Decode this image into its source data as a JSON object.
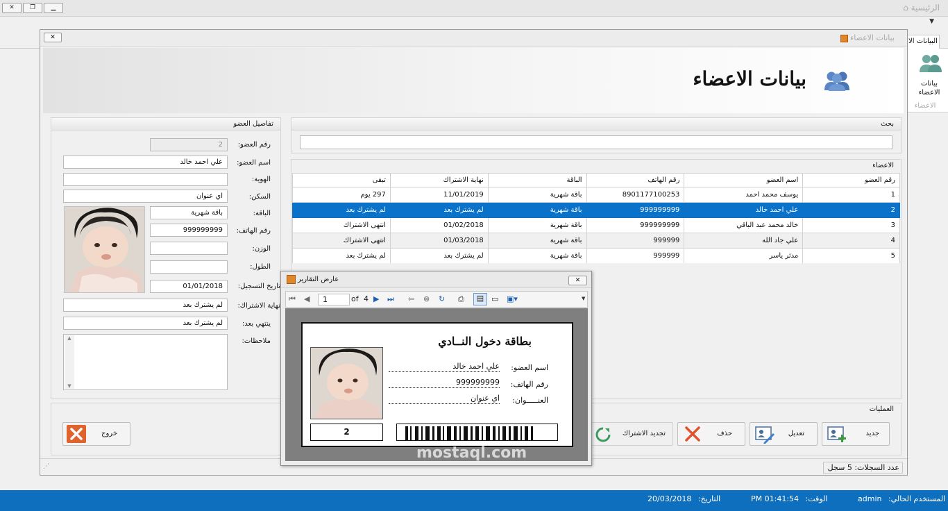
{
  "app": {
    "title": "الرئيسية",
    "window_buttons": [
      "▁",
      "❐",
      "▁"
    ],
    "ribbon_dropdown": "▼",
    "ribbon_tab": "البيانات الا",
    "ribbon_button": "بيانات\nالاعضاء",
    "ribbon_group": "الاعضاء"
  },
  "child": {
    "title": "بيانات الاعضاء",
    "close": "✕",
    "page_title": "بيانات الاعضاء"
  },
  "details": {
    "title": "تفاصيل العضو",
    "fields": [
      {
        "label": "رقم العضو:",
        "value": "2",
        "disabled": true
      },
      {
        "label": "اسم العضو:",
        "value": "علي احمد خالد"
      },
      {
        "label": "الهوية:",
        "value": ""
      },
      {
        "label": "السكن:",
        "value": "اي عنوان"
      },
      {
        "label": "الباقة:",
        "value": "باقة شهرية"
      },
      {
        "label": "رقم الهاتف:",
        "value": "999999999"
      },
      {
        "label": "الوزن:",
        "value": ""
      },
      {
        "label": "الطول:",
        "value": ""
      },
      {
        "label": "تاريخ التسجيل:",
        "value": "01/01/2018"
      },
      {
        "label": "نهاية الاشتراك:",
        "value": "لم يشترك بعد"
      },
      {
        "label": "ينتهي بعد:",
        "value": "لم يشترك بعد"
      },
      {
        "label": "ملاحظات:",
        "value": ""
      }
    ]
  },
  "search": {
    "title": "بحث",
    "value": ""
  },
  "members": {
    "title": "الاعضاء",
    "columns": [
      "رقم العضو",
      "اسم العضو",
      "رقم الهاتف",
      "الباقة",
      "نهاية الاشتراك",
      "تبقى"
    ],
    "rows": [
      [
        "1",
        "يوسف محمد احمد",
        "8901177100253",
        "باقة شهرية",
        "11/01/2019",
        "297 يوم"
      ],
      [
        "2",
        "علي احمد خالد",
        "999999999",
        "باقة شهرية",
        "لم يشترك بعد",
        "لم يشترك بعد"
      ],
      [
        "3",
        "خالد محمد عبد الباقي",
        "999999999",
        "باقة شهرية",
        "01/02/2018",
        "انتهى الاشتراك"
      ],
      [
        "4",
        "علي جاد الله",
        "999999",
        "باقة شهرية",
        "01/03/2018",
        "انتهى الاشتراك"
      ],
      [
        "5",
        "مدثر ياسر",
        "999999",
        "باقة شهرية",
        "لم يشترك بعد",
        "لم يشترك بعد"
      ]
    ],
    "selected_row": 1
  },
  "operations": {
    "title": "العمليات",
    "new": "جديد",
    "edit": "تعديل",
    "delete": "حذف",
    "renew": "تجديد الاشتراك",
    "exit": "خروج"
  },
  "record_count": {
    "label": "عدد السجلات:",
    "value": "5 سجل"
  },
  "report_viewer": {
    "title": "عارض التقارير",
    "close": "✕",
    "page": "1",
    "of_label": "of",
    "total_pages": "4",
    "card": {
      "title": "بطاقة دخول النــادي",
      "name_label": "اسم العضو:",
      "name": "علي احمد خالد",
      "phone_label": "رقم الهاتف:",
      "phone": "999999999",
      "address_label": "العنـــــوان:",
      "address": "اي عنوان",
      "member_no": "2"
    }
  },
  "watermark": "mostaql.com",
  "statusbar": {
    "user_label": "المستخدم الحالي:",
    "user": "admin",
    "time_label": "الوقت:",
    "time": "01:41:54 PM",
    "date_label": "التاريخ:",
    "date": "20/03/2018"
  },
  "colors": {
    "selection": "#0a72c8",
    "taskbar": "#0d6fbe",
    "delete_icon": "#e0522d",
    "members_icon": "#5a86c6"
  }
}
